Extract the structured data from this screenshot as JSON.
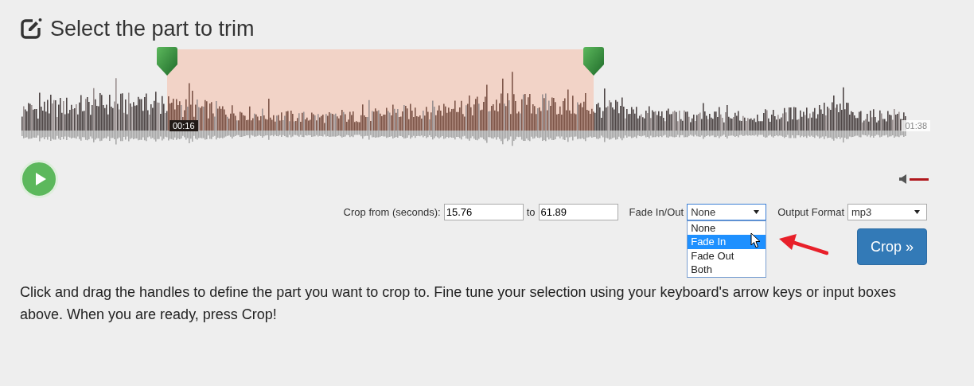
{
  "title": "Select the part to trim",
  "waveform": {
    "selection_start": {
      "level": 0.1608
    },
    "selection_end": {
      "level": 0.6315
    },
    "start_time": "00:16",
    "end_time": "01:38"
  },
  "player": {
    "playing": false,
    "muted": true
  },
  "crop": {
    "from_label": "Crop from (seconds):",
    "from_value": "15.76",
    "to_label": "to",
    "to_value": "61.89"
  },
  "fade": {
    "label": "Fade In/Out",
    "value": "None",
    "open": true,
    "options": [
      {
        "label": "None",
        "highlighted": false
      },
      {
        "label": "Fade In",
        "highlighted": true
      },
      {
        "label": "Fade Out",
        "highlighted": false
      },
      {
        "label": "Both",
        "highlighted": false
      }
    ]
  },
  "output": {
    "label": "Output Format",
    "value": "mp3"
  },
  "crop_button": "Crop »",
  "instructions": "Click and drag the handles to define the part you want to crop to. Fine tune your selection using your keyboard's arrow keys or input boxes above. When you are ready, press Crop!"
}
